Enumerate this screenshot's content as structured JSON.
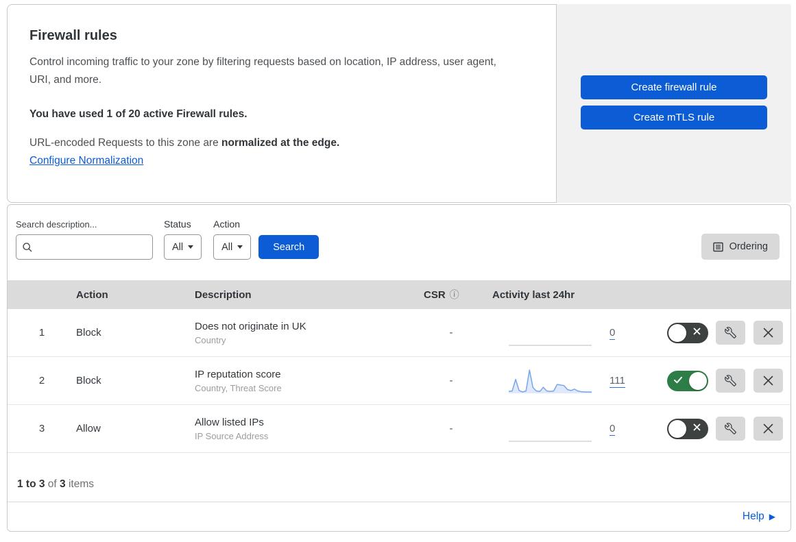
{
  "colors": {
    "accent_blue": "#0b5cd5",
    "toggle_on": "#2d7e46",
    "toggle_off": "#3d4140",
    "sparkline_stroke": "#78a5ec",
    "sparkline_fill": "#dfe9fb",
    "panel_gray": "#f1f1f2",
    "table_header_gray": "#dbdbdb"
  },
  "header": {
    "title": "Firewall rules",
    "description": "Control incoming traffic to your zone by filtering requests based on location, IP address, user agent, URI, and more.",
    "usage_statement": "You have used 1 of 20 active Firewall rules.",
    "normalization_prefix": "URL-encoded Requests to this zone are ",
    "normalization_bold": "normalized at the edge.",
    "normalization_link": "Configure Normalization"
  },
  "actions_panel": {
    "create_firewall_rule_label": "Create firewall rule",
    "create_mtls_rule_label": "Create mTLS rule"
  },
  "filters": {
    "search_label": "Search description...",
    "search_value": "",
    "status_label": "Status",
    "status_value": "All",
    "action_label": "Action",
    "action_value": "All",
    "search_button_label": "Search",
    "ordering_button_label": "Ordering"
  },
  "table": {
    "columns": {
      "action": "Action",
      "description": "Description",
      "csr": "CSR",
      "activity": "Activity last 24hr"
    },
    "rows": [
      {
        "priority": "1",
        "action": "Block",
        "description": "Does not originate in UK",
        "fields": "Country",
        "csr": "-",
        "activity_count": "0",
        "enabled": false
      },
      {
        "priority": "2",
        "action": "Block",
        "description": "IP reputation score",
        "fields": "Country, Threat Score",
        "csr": "-",
        "activity_count": "111",
        "enabled": true,
        "sparkline": [
          8,
          10,
          60,
          12,
          6,
          10,
          100,
          25,
          10,
          8,
          26,
          10,
          8,
          10,
          38,
          36,
          33,
          16,
          12,
          18,
          10,
          7,
          6,
          6,
          5
        ]
      },
      {
        "priority": "3",
        "action": "Allow",
        "description": "Allow listed IPs",
        "fields": "IP Source Address",
        "csr": "-",
        "activity_count": "0",
        "enabled": false
      }
    ]
  },
  "footer": {
    "range_bold": "1 to 3",
    "of_text": " of ",
    "total_bold": "3",
    "items_text": " items"
  },
  "help": {
    "label": "Help",
    "arrow": "▶"
  },
  "icons": {
    "search_icon": "magnifying-glass",
    "info_icon": "circled-i",
    "ordering_icon": "list-document",
    "wrench_icon": "wrench",
    "close_icon": "x-cross",
    "toggle_check_icon": "checkmark",
    "toggle_cross_icon": "x-cross",
    "caret_down_icon": "triangle-down"
  }
}
